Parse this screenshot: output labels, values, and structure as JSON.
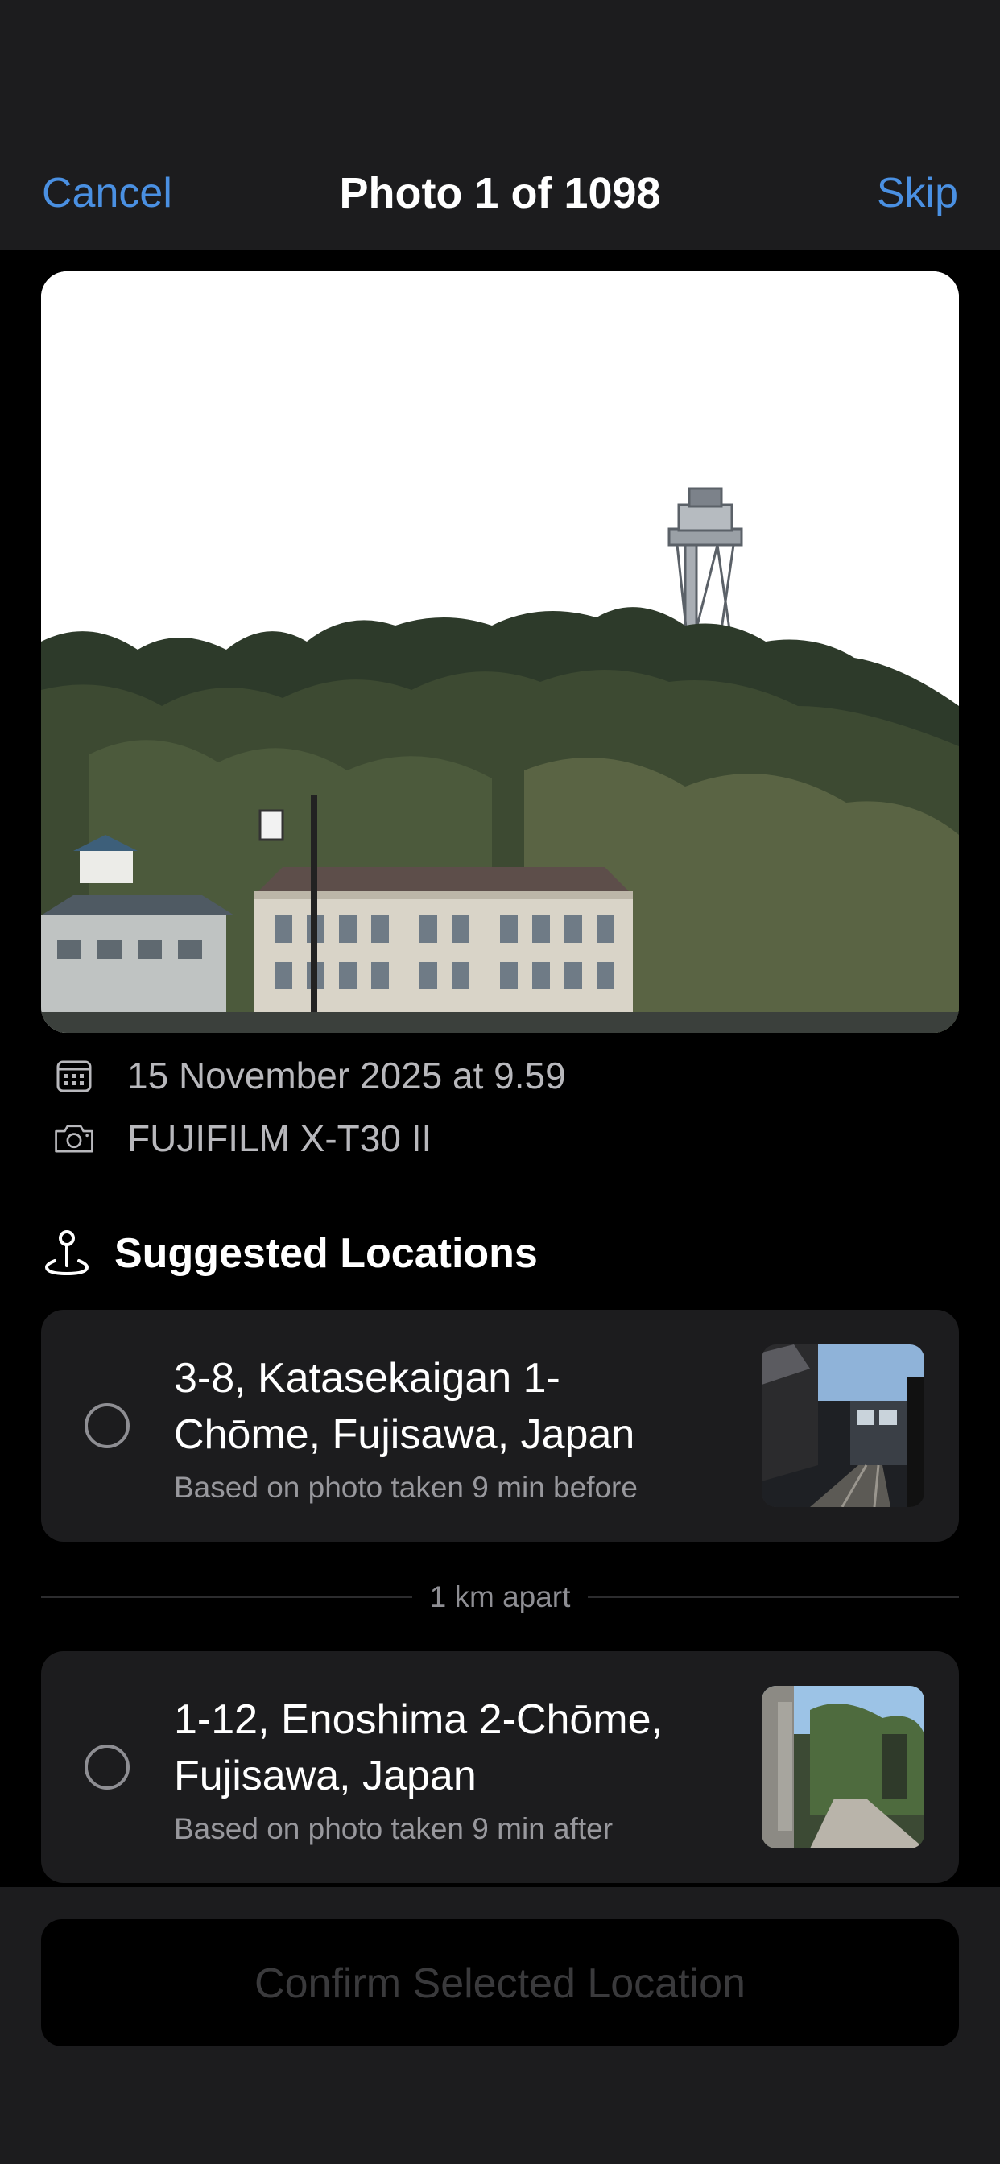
{
  "nav": {
    "cancel_label": "Cancel",
    "title": "Photo 1 of 1098",
    "skip_label": "Skip"
  },
  "photo": {
    "date": "15 November 2025 at 9.59",
    "camera": "FUJIFILM X-T30 II",
    "date_icon": "calendar-icon",
    "camera_icon": "camera-icon"
  },
  "suggested": {
    "title": "Suggested Locations",
    "icon": "location-pin-icon",
    "items": [
      {
        "line1": "3-8, Katasekaigan 1-",
        "line2": "Chōme, Fujisawa, Japan",
        "subtitle": "Based on photo taken 9 min before"
      },
      {
        "line1": "1-12, Enoshima 2-Chōme,",
        "line2": "Fujisawa, Japan",
        "subtitle": "Based on photo taken 9 min after"
      }
    ],
    "separator": "1 km apart"
  },
  "footer": {
    "confirm_label": "Confirm Selected Location"
  },
  "colors": {
    "accent": "#4a90e2",
    "background": "#000000",
    "surface": "#1c1c1e"
  }
}
